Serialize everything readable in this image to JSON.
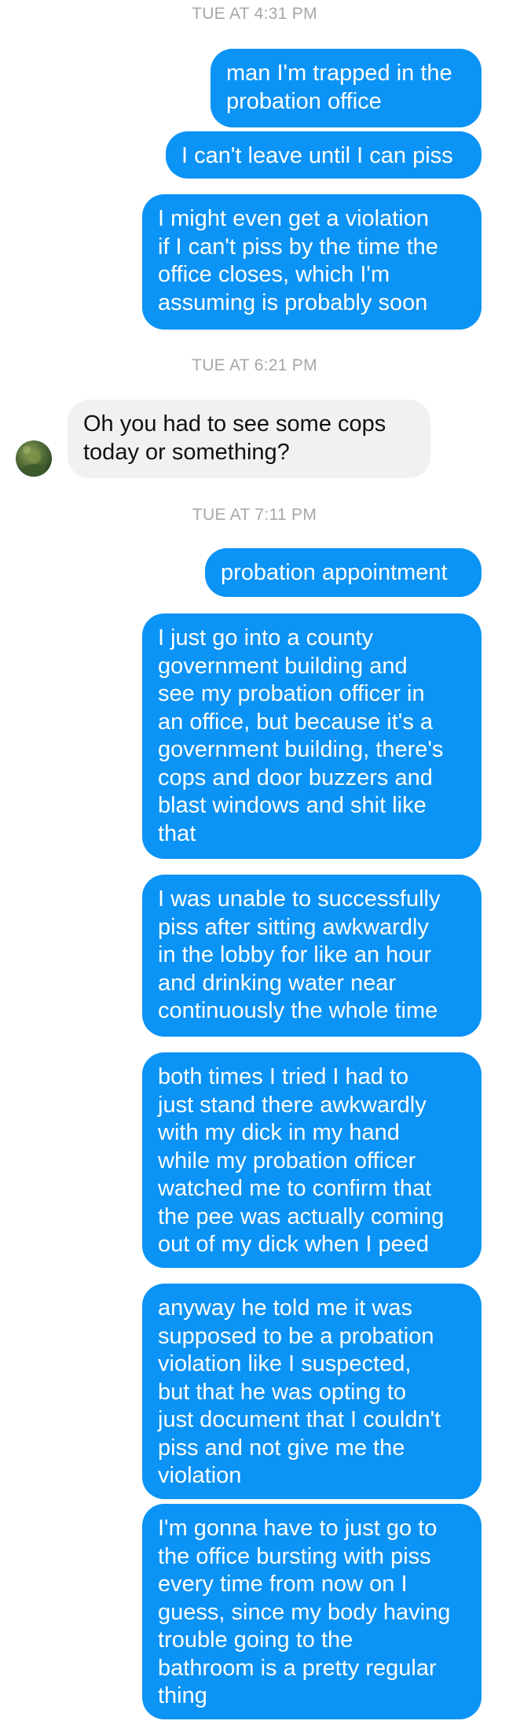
{
  "conversation": {
    "timestamps": [
      "TUE AT 4:31 PM",
      "TUE AT 6:21 PM",
      "TUE AT 7:11 PM"
    ],
    "messages": [
      {
        "from": "me",
        "text": "man I'm trapped in the\nprobation office"
      },
      {
        "from": "me",
        "text": "I can't leave until I can piss"
      },
      {
        "from": "me",
        "text": "I might even get a violation\nif I can't piss by the time the\noffice closes, which I'm\nassuming is probably soon"
      },
      {
        "from": "them",
        "text": "Oh you had to see some cops\ntoday or something?"
      },
      {
        "from": "me",
        "text": "probation appointment"
      },
      {
        "from": "me",
        "text": "I just go into a county\ngovernment building and\nsee my probation officer in\nan office, but because it's a\ngovernment building, there's\ncops and door buzzers and\nblast windows and shit like\nthat"
      },
      {
        "from": "me",
        "text": "I was unable to successfully\npiss after sitting awkwardly\nin the lobby for like an hour\nand drinking water near\ncontinuously the whole time"
      },
      {
        "from": "me",
        "text": "both times I tried I had to\njust stand there awkwardly\nwith my dick in my hand\nwhile my probation officer\nwatched me to confirm that\nthe pee was actually coming\nout of my dick when I peed"
      },
      {
        "from": "me",
        "text": "anyway he told me it was\nsupposed to be a probation\nviolation like I suspected,\nbut that he was opting to\njust document that I couldn't\npiss and not give me the\nviolation"
      },
      {
        "from": "me",
        "text": "I'm gonna have to just go to\nthe office bursting with piss\nevery time from now on I\nguess, since my body having\ntrouble going to the\nbathroom is a pretty regular\nthing"
      }
    ]
  },
  "colors": {
    "outgoing_bubble": "#0b93f6",
    "incoming_bubble": "#f1f1f1",
    "timestamp_text": "#a7a7a7"
  },
  "icons": {
    "contact_avatar": "avatar-photo"
  }
}
